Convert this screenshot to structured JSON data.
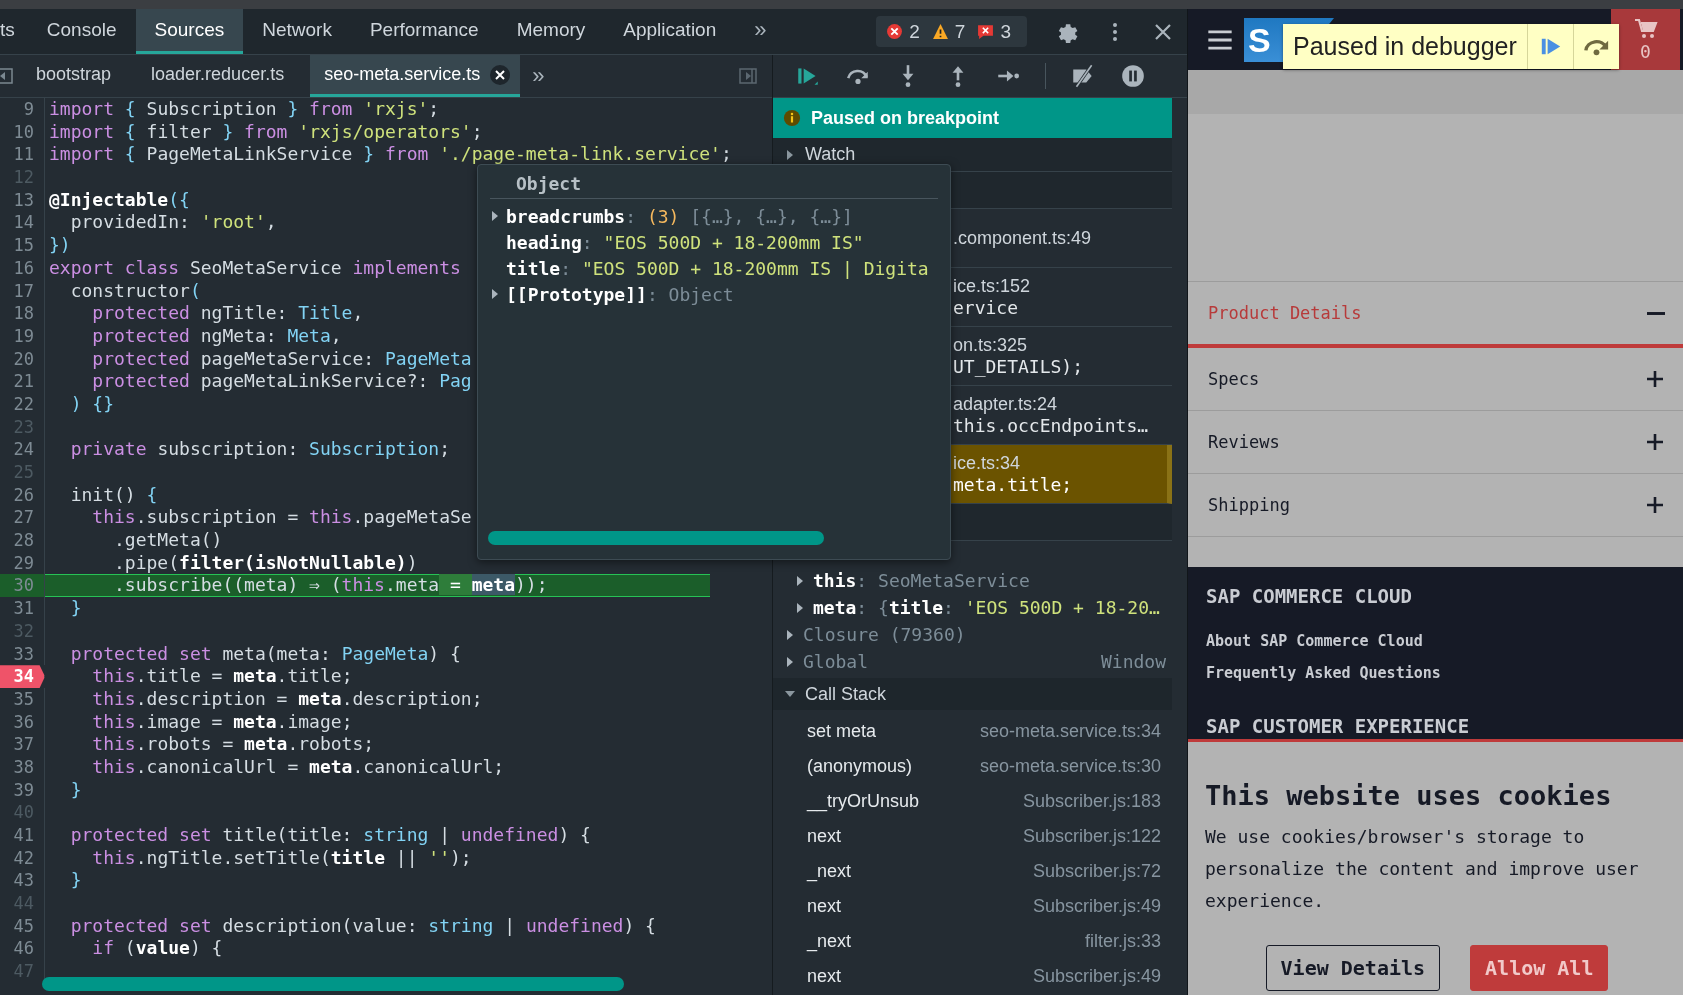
{
  "devtools": {
    "panel_tabs": [
      {
        "label": "ts",
        "selected": false
      },
      {
        "label": "Console",
        "selected": false
      },
      {
        "label": "Sources",
        "selected": true
      },
      {
        "label": "Network",
        "selected": false
      },
      {
        "label": "Performance",
        "selected": false
      },
      {
        "label": "Memory",
        "selected": false
      },
      {
        "label": "Application",
        "selected": false
      }
    ],
    "more_tabs": "»",
    "counts": {
      "errors": "2",
      "warnings": "7",
      "issues": "3"
    },
    "file_tabs": [
      {
        "label": "bootstrap",
        "selected": false
      },
      {
        "label": "loader.reducer.ts",
        "selected": false
      },
      {
        "label": "seo-meta.service.ts",
        "selected": true
      }
    ],
    "more_files": "»",
    "code_lines": [
      {
        "n": "9",
        "breakpoint": false,
        "paused": false,
        "tokens": [
          {
            "text": "import",
            "kind": "kw"
          },
          {
            "text": " { ",
            "kind": "punct"
          },
          {
            "text": "Subscription",
            "kind": "plain"
          },
          {
            "text": " } ",
            "kind": "punct"
          },
          {
            "text": "from",
            "kind": "kw"
          },
          {
            "text": " 'rxjs'",
            "kind": "str"
          },
          {
            "text": ";",
            "kind": "plain"
          }
        ]
      },
      {
        "n": "10",
        "breakpoint": false,
        "paused": false,
        "tokens": [
          {
            "text": "import",
            "kind": "kw"
          },
          {
            "text": " { ",
            "kind": "punct"
          },
          {
            "text": "filter",
            "kind": "plain"
          },
          {
            "text": " } ",
            "kind": "punct"
          },
          {
            "text": "from",
            "kind": "kw"
          },
          {
            "text": " 'rxjs/operators'",
            "kind": "str"
          },
          {
            "text": ";",
            "kind": "plain"
          }
        ]
      },
      {
        "n": "11",
        "breakpoint": false,
        "paused": false,
        "tokens": [
          {
            "text": "import",
            "kind": "kw"
          },
          {
            "text": " { ",
            "kind": "punct"
          },
          {
            "text": "PageMetaLinkService",
            "kind": "plain"
          },
          {
            "text": " } ",
            "kind": "punct"
          },
          {
            "text": "from",
            "kind": "kw"
          },
          {
            "text": " './page-meta-link.service'",
            "kind": "str"
          },
          {
            "text": ";",
            "kind": "plain"
          }
        ]
      },
      {
        "n": "12",
        "breakpoint": false,
        "paused": false
      },
      {
        "n": "13",
        "breakpoint": false,
        "paused": false,
        "tokens": [
          {
            "text": "@Injectable",
            "kind": "strong"
          },
          {
            "text": "({",
            "kind": "punct"
          }
        ]
      },
      {
        "n": "14",
        "breakpoint": false,
        "paused": false,
        "tokens": [
          {
            "text": "  providedIn: ",
            "kind": "plain"
          },
          {
            "text": "'root'",
            "kind": "str"
          },
          {
            "text": ",",
            "kind": "plain"
          }
        ]
      },
      {
        "n": "15",
        "breakpoint": false,
        "paused": false,
        "tokens": [
          {
            "text": "})",
            "kind": "punct"
          }
        ]
      },
      {
        "n": "16",
        "breakpoint": false,
        "paused": false,
        "tokens": [
          {
            "text": "export",
            "kind": "kw"
          },
          {
            "text": " class",
            "kind": "kw"
          },
          {
            "text": " SeoMetaService ",
            "kind": "plain"
          },
          {
            "text": "implements",
            "kind": "kw"
          }
        ]
      },
      {
        "n": "17",
        "breakpoint": false,
        "paused": false,
        "tokens": [
          {
            "text": "  constructor",
            "kind": "plain"
          },
          {
            "text": "(",
            "kind": "punct"
          }
        ]
      },
      {
        "n": "18",
        "breakpoint": false,
        "paused": false,
        "tokens": [
          {
            "text": "    protected",
            "kind": "kw"
          },
          {
            "text": " ngTitle: ",
            "kind": "plain"
          },
          {
            "text": "Title",
            "kind": "type"
          },
          {
            "text": ",",
            "kind": "plain"
          }
        ]
      },
      {
        "n": "19",
        "breakpoint": false,
        "paused": false,
        "tokens": [
          {
            "text": "    protected",
            "kind": "kw"
          },
          {
            "text": " ngMeta: ",
            "kind": "plain"
          },
          {
            "text": "Meta",
            "kind": "type"
          },
          {
            "text": ",",
            "kind": "plain"
          }
        ]
      },
      {
        "n": "20",
        "breakpoint": false,
        "paused": false,
        "tokens": [
          {
            "text": "    protected",
            "kind": "kw"
          },
          {
            "text": " pageMetaService: ",
            "kind": "plain"
          },
          {
            "text": "PageMeta",
            "kind": "type"
          }
        ]
      },
      {
        "n": "21",
        "breakpoint": false,
        "paused": false,
        "tokens": [
          {
            "text": "    protected",
            "kind": "kw"
          },
          {
            "text": " pageMetaLinkService?: ",
            "kind": "plain"
          },
          {
            "text": "Pag",
            "kind": "type"
          }
        ]
      },
      {
        "n": "22",
        "breakpoint": false,
        "paused": false,
        "tokens": [
          {
            "text": "  ) {}",
            "kind": "punct"
          }
        ]
      },
      {
        "n": "23",
        "breakpoint": false,
        "paused": false
      },
      {
        "n": "24",
        "breakpoint": false,
        "paused": false,
        "tokens": [
          {
            "text": "  private",
            "kind": "kw"
          },
          {
            "text": " subscription: ",
            "kind": "plain"
          },
          {
            "text": "Subscription",
            "kind": "type"
          },
          {
            "text": ";",
            "kind": "plain"
          }
        ]
      },
      {
        "n": "25",
        "breakpoint": false,
        "paused": false
      },
      {
        "n": "26",
        "breakpoint": false,
        "paused": false,
        "tokens": [
          {
            "text": "  init() ",
            "kind": "plain"
          },
          {
            "text": "{",
            "kind": "punct"
          }
        ]
      },
      {
        "n": "27",
        "breakpoint": false,
        "paused": false,
        "tokens": [
          {
            "text": "    this",
            "kind": "kw"
          },
          {
            "text": ".subscription = ",
            "kind": "plain"
          },
          {
            "text": "this",
            "kind": "kw"
          },
          {
            "text": ".pageMetaSe",
            "kind": "plain"
          }
        ]
      },
      {
        "n": "28",
        "breakpoint": false,
        "paused": false,
        "tokens": [
          {
            "text": "      .getMeta()",
            "kind": "plain"
          }
        ]
      },
      {
        "n": "29",
        "breakpoint": false,
        "paused": false,
        "tokens": [
          {
            "text": "      .pipe(",
            "kind": "plain"
          },
          {
            "text": "filter(isNotNullable)",
            "kind": "strong"
          },
          {
            "text": ")",
            "kind": "plain"
          }
        ]
      },
      {
        "n": "30",
        "breakpoint": false,
        "paused": true,
        "tokens": [
          {
            "text": "      .subscribe((meta) ⇒ (",
            "kind": "plain"
          },
          {
            "text": "this",
            "kind": "kw"
          },
          {
            "text": ".meta",
            "kind": "plain"
          },
          {
            "text": " = ",
            "kind": "eval"
          },
          {
            "text": "meta",
            "kind": "evalstrong"
          },
          {
            "text": "));",
            "kind": "plain"
          }
        ]
      },
      {
        "n": "31",
        "breakpoint": false,
        "paused": false,
        "tokens": [
          {
            "text": "  }",
            "kind": "punct"
          }
        ]
      },
      {
        "n": "32",
        "breakpoint": false,
        "paused": false
      },
      {
        "n": "33",
        "breakpoint": false,
        "paused": false,
        "tokens": [
          {
            "text": "  protected",
            "kind": "kw"
          },
          {
            "text": " set",
            "kind": "kw"
          },
          {
            "text": " meta(meta: ",
            "kind": "plain"
          },
          {
            "text": "PageMeta",
            "kind": "type"
          },
          {
            "text": ") {",
            "kind": "plain"
          }
        ]
      },
      {
        "n": "34",
        "breakpoint": true,
        "paused": false,
        "tokens": [
          {
            "text": "    this",
            "kind": "kw"
          },
          {
            "text": ".title = ",
            "kind": "plain"
          },
          {
            "text": "meta",
            "kind": "strong"
          },
          {
            "text": ".title;",
            "kind": "plain"
          }
        ]
      },
      {
        "n": "35",
        "breakpoint": false,
        "paused": false,
        "tokens": [
          {
            "text": "    this",
            "kind": "kw"
          },
          {
            "text": ".description = ",
            "kind": "plain"
          },
          {
            "text": "meta",
            "kind": "strong"
          },
          {
            "text": ".description;",
            "kind": "plain"
          }
        ]
      },
      {
        "n": "36",
        "breakpoint": false,
        "paused": false,
        "tokens": [
          {
            "text": "    this",
            "kind": "kw"
          },
          {
            "text": ".image = ",
            "kind": "plain"
          },
          {
            "text": "meta",
            "kind": "strong"
          },
          {
            "text": ".image;",
            "kind": "plain"
          }
        ]
      },
      {
        "n": "37",
        "breakpoint": false,
        "paused": false,
        "tokens": [
          {
            "text": "    this",
            "kind": "kw"
          },
          {
            "text": ".robots = ",
            "kind": "plain"
          },
          {
            "text": "meta",
            "kind": "strong"
          },
          {
            "text": ".robots;",
            "kind": "plain"
          }
        ]
      },
      {
        "n": "38",
        "breakpoint": false,
        "paused": false,
        "tokens": [
          {
            "text": "    this",
            "kind": "kw"
          },
          {
            "text": ".canonicalUrl = ",
            "kind": "plain"
          },
          {
            "text": "meta",
            "kind": "strong"
          },
          {
            "text": ".canonicalUrl;",
            "kind": "plain"
          }
        ]
      },
      {
        "n": "39",
        "breakpoint": false,
        "paused": false,
        "tokens": [
          {
            "text": "  }",
            "kind": "punct"
          }
        ]
      },
      {
        "n": "40",
        "breakpoint": false,
        "paused": false
      },
      {
        "n": "41",
        "breakpoint": false,
        "paused": false,
        "tokens": [
          {
            "text": "  protected",
            "kind": "kw"
          },
          {
            "text": " set",
            "kind": "kw"
          },
          {
            "text": " title(title: ",
            "kind": "plain"
          },
          {
            "text": "string",
            "kind": "type"
          },
          {
            "text": " | ",
            "kind": "plain"
          },
          {
            "text": "undefined",
            "kind": "kw"
          },
          {
            "text": ") {",
            "kind": "plain"
          }
        ]
      },
      {
        "n": "42",
        "breakpoint": false,
        "paused": false,
        "tokens": [
          {
            "text": "    this",
            "kind": "kw"
          },
          {
            "text": ".ngTitle.setTitle(",
            "kind": "plain"
          },
          {
            "text": "title",
            "kind": "strong"
          },
          {
            "text": " || ",
            "kind": "plain"
          },
          {
            "text": "''",
            "kind": "str"
          },
          {
            "text": ");",
            "kind": "plain"
          }
        ]
      },
      {
        "n": "43",
        "breakpoint": false,
        "paused": false,
        "tokens": [
          {
            "text": "  }",
            "kind": "punct"
          }
        ]
      },
      {
        "n": "44",
        "breakpoint": false,
        "paused": false
      },
      {
        "n": "45",
        "breakpoint": false,
        "paused": false,
        "tokens": [
          {
            "text": "  protected",
            "kind": "kw"
          },
          {
            "text": " set",
            "kind": "kw"
          },
          {
            "text": " description(value: ",
            "kind": "plain"
          },
          {
            "text": "string",
            "kind": "type"
          },
          {
            "text": " | ",
            "kind": "plain"
          },
          {
            "text": "undefined",
            "kind": "kw"
          },
          {
            "text": ") {",
            "kind": "plain"
          }
        ]
      },
      {
        "n": "46",
        "breakpoint": false,
        "paused": false,
        "tokens": [
          {
            "text": "    if",
            "kind": "kw"
          },
          {
            "text": " (",
            "kind": "plain"
          },
          {
            "text": "value",
            "kind": "strong"
          },
          {
            "text": ") {",
            "kind": "plain"
          }
        ]
      },
      {
        "n": "47",
        "breakpoint": false,
        "paused": false
      }
    ],
    "popover": {
      "title": "Object",
      "properties": [
        {
          "name": "breadcrumbs",
          "expanded": false,
          "value": [
            {
              "text": ": ",
              "kind": "dim"
            },
            {
              "text": "(3)",
              "kind": "count"
            },
            {
              "text": " [{…}, {…}, {…}]",
              "kind": "dim"
            }
          ]
        },
        {
          "name": "heading",
          "value": [
            {
              "text": ": ",
              "kind": "dim"
            },
            {
              "text": "\"EOS 500D + 18-200mm IS\"",
              "kind": "str"
            }
          ]
        },
        {
          "name": "title",
          "value": [
            {
              "text": ": ",
              "kind": "dim"
            },
            {
              "text": "\"EOS 500D + 18-200mm IS | Digita",
              "kind": "str"
            }
          ]
        },
        {
          "name": "[[Prototype]]",
          "expanded": false,
          "value": [
            {
              "text": ": ",
              "kind": "dim"
            },
            {
              "text": "Object",
              "kind": "dim"
            }
          ]
        }
      ]
    },
    "debugger": {
      "banner": "Paused on breakpoint",
      "watch": {
        "label": "Watch",
        "expanded": false
      },
      "breakpoints": [
        {
          "file": ".component.ts:49",
          "selected": false
        },
        {
          "file": "ice.ts:152",
          "code": "ervice",
          "selected": false
        },
        {
          "file": "on.ts:325",
          "code": "UT_DETAILS);",
          "selected": false
        },
        {
          "file": "adapter.ts:24",
          "code": "this.occEndpoints…",
          "selected": false
        },
        {
          "file": "ice.ts:34",
          "code": "meta.title;",
          "selected": true
        }
      ],
      "scope": [
        {
          "kind": "var",
          "name": "this",
          "expanded": false,
          "value": [
            {
              "text": ": ",
              "kind": "dim"
            },
            {
              "text": "SeoMetaService",
              "kind": "dim"
            }
          ]
        },
        {
          "kind": "var",
          "name": "meta",
          "expanded": false,
          "value": [
            {
              "text": ": {",
              "kind": "dim"
            },
            {
              "text": "title",
              "kind": "strong"
            },
            {
              "text": ": ",
              "kind": "dim"
            },
            {
              "text": "'EOS 500D + 18-20…",
              "kind": "str"
            }
          ]
        },
        {
          "kind": "group",
          "name": "Closure (79360)",
          "expanded": false
        },
        {
          "kind": "group",
          "name": "Global",
          "expanded": false,
          "value": [
            {
              "text": "Window",
              "kind": "dim"
            }
          ]
        }
      ],
      "call_stack": {
        "title": "Call Stack",
        "expanded": true,
        "frames": [
          {
            "name": "set meta",
            "location": "seo-meta.service.ts:34"
          },
          {
            "name": "(anonymous)",
            "location": "seo-meta.service.ts:30"
          },
          {
            "name": "__tryOrUnsub",
            "location": "Subscriber.js:183"
          },
          {
            "name": "next",
            "location": "Subscriber.js:122"
          },
          {
            "name": "_next",
            "location": "Subscriber.js:72"
          },
          {
            "name": "next",
            "location": "Subscriber.js:49"
          },
          {
            "name": "_next",
            "location": "filter.js:33"
          },
          {
            "name": "next",
            "location": "Subscriber.js:49"
          }
        ]
      }
    }
  },
  "page": {
    "logo": "S",
    "paused_overlay": "Paused in debugger",
    "cart_count": "0",
    "accordion": [
      {
        "label": "Product Details",
        "expanded": true
      },
      {
        "label": "Specs",
        "expanded": false
      },
      {
        "label": "Reviews",
        "expanded": false
      },
      {
        "label": "Shipping",
        "expanded": false
      }
    ],
    "footer": [
      {
        "heading": "SAP COMMERCE CLOUD",
        "links": [
          "About SAP Commerce Cloud",
          "Frequently Asked Questions"
        ]
      },
      {
        "heading": "SAP CUSTOMER EXPERIENCE"
      }
    ],
    "cookie_banner": {
      "title": "This website uses cookies",
      "text": "We use cookies/browser's storage to personalize the content and improve user experience.",
      "buttons": [
        {
          "label": "View Details",
          "kind": "secondary"
        },
        {
          "label": "Allow All",
          "kind": "primary"
        }
      ]
    }
  }
}
